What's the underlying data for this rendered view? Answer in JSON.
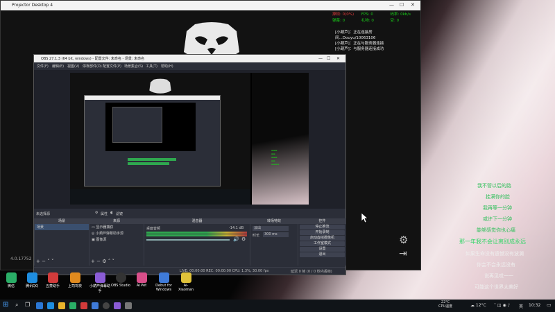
{
  "projector": {
    "title": "Projector Desktop 4",
    "version": "4.0.17752"
  },
  "stats": {
    "row1": [
      "掉帧: 0(0%)",
      "FPS: 0",
      "码率: 0kb/s"
    ],
    "row2": [
      "弹幕: 0",
      "礼物: 0",
      "受: 0"
    ]
  },
  "chat": [
    "[小葫芦]：正在连接房",
    "间...Douyu/10063106",
    "[小葫芦]：正在与服务器连接",
    "[小葫芦]：与服务器连接成功"
  ],
  "obs": {
    "title": "OBS 27.1.3 (64 bit, windows) - 配置文件: 未命名 - 场景: 未命名",
    "menu": [
      "文件(F)",
      "编辑(E)",
      "视图(V)",
      "停靠部件(D)",
      "配置文件(P)",
      "场景集合(S)",
      "工具(T)",
      "帮助(H)"
    ],
    "scene_bar": [
      "未选择源",
      "属性",
      "滤镜"
    ],
    "docks": {
      "scenes": {
        "title": "场景",
        "items": [
          "场景"
        ]
      },
      "sources": {
        "title": "来源",
        "items": [
          "显示器捕获",
          "小葫芦弹幕助手源",
          "图像源"
        ]
      },
      "mixer": {
        "title": "混音器",
        "channel": "桌面音频",
        "db": "-14.1 dB"
      },
      "transitions": {
        "title": "转场特效",
        "type": "淡出",
        "duration_label": "时长",
        "duration": "300 ms"
      },
      "controls": {
        "title": "控件",
        "buttons": [
          "停止推流",
          "开始录制",
          "启动虚拟摄像机",
          "工作室模式",
          "设置",
          "退出"
        ]
      }
    },
    "status": "LIVE: 00:00:00   REC: 00:00:00   CPU: 1.3%, 30.00 fps",
    "status_right": "延迟 0 帧 (0 / 0 秒内丢帧)"
  },
  "lyrics": [
    "我不管以后的路",
    "挂满你的脸",
    "我再等一分钟",
    "或许下一分钟",
    "能够感觉你也心痛",
    "那一年我不会让离别成永远",
    "如果生命没有遗憾没有波澜",
    "你会不会永远没有",
    "说再见哎一一",
    "可能这个世界太美好"
  ],
  "desktop_icons": [
    "微信",
    "腾讯QQ",
    "五菱助手",
    "上司驾校",
    "小葫芦弹幕助手",
    "OBS Studio",
    "AI Pet",
    "Debut for Windows",
    "Ai-Xiaoman"
  ],
  "taskbar": {
    "weather": "12°C",
    "weather2": "22°C",
    "cpu_label": "CPU温度",
    "time": "10:32",
    "lang": "英"
  },
  "colors": {
    "green": "#19c819",
    "red": "#e03a3a",
    "obs_bg": "#2b2e38",
    "lyric": "#38d66b"
  }
}
